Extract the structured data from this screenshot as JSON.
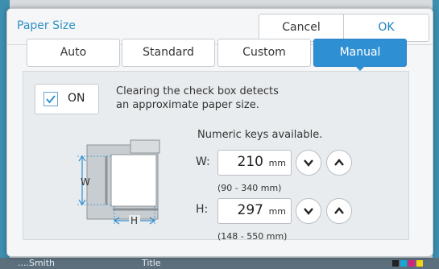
{
  "background": {
    "user_text": "....Smith",
    "title_text": "Title"
  },
  "dialog": {
    "title": "Paper Size",
    "cancel_label": "Cancel",
    "ok_label": "OK"
  },
  "tabs": [
    {
      "label": "Auto",
      "selected": false
    },
    {
      "label": "Standard",
      "selected": false
    },
    {
      "label": "Custom",
      "selected": false
    },
    {
      "label": "Manual",
      "selected": true
    }
  ],
  "manual": {
    "on_label": "ON",
    "on_checked": true,
    "help_line1": "Clearing the check box detects",
    "help_line2": "an approximate paper size.",
    "numeric_note": "Numeric keys available.",
    "diagram_w_label": "W",
    "diagram_h_label": "H",
    "width": {
      "label": "W:",
      "value": "210",
      "unit": "mm",
      "range": "(90 - 340 mm)"
    },
    "height": {
      "label": "H:",
      "value": "297",
      "unit": "mm",
      "range": "(148 - 550 mm)"
    }
  },
  "colors": {
    "accent": "#2f8fd3",
    "title": "#2e8fc6",
    "ok": "#1c7fbf"
  },
  "icons": {
    "check": "check-icon",
    "down": "chevron-down-icon",
    "up": "chevron-up-icon"
  }
}
